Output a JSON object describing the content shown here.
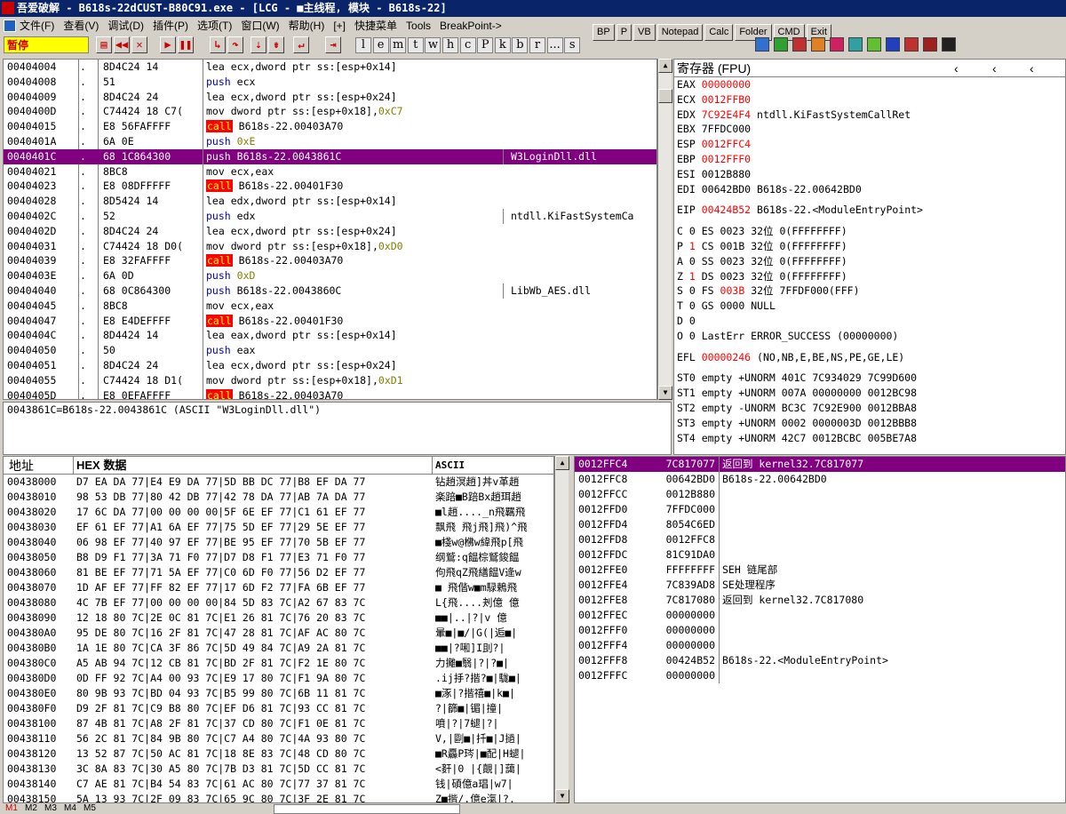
{
  "title": "吾爱破解 - B618s-22dCUST-B80C91.exe - [LCG - ■主线程, 模块 - B618s-22]",
  "menu": [
    "文件(F)",
    "查看(V)",
    "调试(D)",
    "插件(P)",
    "选项(T)",
    "窗口(W)",
    "帮助(H)",
    "[+]",
    "快捷菜单",
    "Tools",
    "BreakPoint->"
  ],
  "quick_buttons": [
    "BP",
    "P",
    "VB",
    "Notepad",
    "Calc",
    "Folder",
    "CMD",
    "Exit"
  ],
  "status": "暂停",
  "letters": [
    "l",
    "e",
    "m",
    "t",
    "w",
    "h",
    "c",
    "P",
    "k",
    "b",
    "r",
    "...",
    "s"
  ],
  "colors": {
    "selection": "#800080",
    "call_bg": "#ff0000",
    "paused_bg": "#ffff00",
    "title_bg": "#0a246a"
  },
  "cpu": [
    {
      "addr": "00404004",
      "dot": ".",
      "hex": "8D4C24 14",
      "op": "lea",
      "args": "ecx,dword ptr ss:[esp+0x14]",
      "cmt": ""
    },
    {
      "addr": "00404008",
      "dot": ".",
      "hex": "51",
      "op": "push",
      "args": "ecx",
      "cmt": ""
    },
    {
      "addr": "00404009",
      "dot": ".",
      "hex": "8D4C24 24",
      "op": "lea",
      "args": "ecx,dword ptr ss:[esp+0x24]",
      "cmt": ""
    },
    {
      "addr": "0040400D",
      "dot": ".",
      "hex": "C74424 18 C7(",
      "op": "mov",
      "args": "dword ptr ss:[esp+0x18],",
      "imm": "0xC7",
      "cmt": ""
    },
    {
      "addr": "00404015",
      "dot": ".",
      "hex": "E8 56FAFFFF",
      "op": "call",
      "args": "B618s-22.00403A70",
      "cmt": ""
    },
    {
      "addr": "0040401A",
      "dot": ".",
      "hex": "6A 0E",
      "op": "push",
      "args": "",
      "imm": "0xE",
      "cmt": ""
    },
    {
      "addr": "0040401C",
      "dot": ".",
      "hex": "68 1C864300",
      "op": "push",
      "args": "B618s-22.0043861C",
      "cmt": "W3LoginDll.dll",
      "sel": true
    },
    {
      "addr": "00404021",
      "dot": ".",
      "hex": "8BC8",
      "op": "mov",
      "args": "ecx,eax",
      "cmt": ""
    },
    {
      "addr": "00404023",
      "dot": ".",
      "hex": "E8 08DFFFFF",
      "op": "call",
      "args": "B618s-22.00401F30",
      "cmt": ""
    },
    {
      "addr": "00404028",
      "dot": ".",
      "hex": "8D5424 14",
      "op": "lea",
      "args": "edx,dword ptr ss:[esp+0x14]",
      "cmt": ""
    },
    {
      "addr": "0040402C",
      "dot": ".",
      "hex": "52",
      "op": "push",
      "args": "edx",
      "cmt": "ntdll.KiFastSystemCa"
    },
    {
      "addr": "0040402D",
      "dot": ".",
      "hex": "8D4C24 24",
      "op": "lea",
      "args": "ecx,dword ptr ss:[esp+0x24]",
      "cmt": ""
    },
    {
      "addr": "00404031",
      "dot": ".",
      "hex": "C74424 18 D0(",
      "op": "mov",
      "args": "dword ptr ss:[esp+0x18],",
      "imm": "0xD0",
      "cmt": ""
    },
    {
      "addr": "00404039",
      "dot": ".",
      "hex": "E8 32FAFFFF",
      "op": "call",
      "args": "B618s-22.00403A70",
      "cmt": ""
    },
    {
      "addr": "0040403E",
      "dot": ".",
      "hex": "6A 0D",
      "op": "push",
      "args": "",
      "imm": "0xD",
      "cmt": ""
    },
    {
      "addr": "00404040",
      "dot": ".",
      "hex": "68 0C864300",
      "op": "push",
      "args": "B618s-22.0043860C",
      "cmt": "LibWb_AES.dll"
    },
    {
      "addr": "00404045",
      "dot": ".",
      "hex": "8BC8",
      "op": "mov",
      "args": "ecx,eax",
      "cmt": ""
    },
    {
      "addr": "00404047",
      "dot": ".",
      "hex": "E8 E4DEFFFF",
      "op": "call",
      "args": "B618s-22.00401F30",
      "cmt": ""
    },
    {
      "addr": "0040404C",
      "dot": ".",
      "hex": "8D4424 14",
      "op": "lea",
      "args": "eax,dword ptr ss:[esp+0x14]",
      "cmt": ""
    },
    {
      "addr": "00404050",
      "dot": ".",
      "hex": "50",
      "op": "push",
      "args": "eax",
      "cmt": ""
    },
    {
      "addr": "00404051",
      "dot": ".",
      "hex": "8D4C24 24",
      "op": "lea",
      "args": "ecx,dword ptr ss:[esp+0x24]",
      "cmt": ""
    },
    {
      "addr": "00404055",
      "dot": ".",
      "hex": "C74424 18 D1(",
      "op": "mov",
      "args": "dword ptr ss:[esp+0x18],",
      "imm": "0xD1",
      "cmt": ""
    },
    {
      "addr": "0040405D",
      "dot": ".",
      "hex": "E8 0EFAFFFF",
      "op": "call",
      "args": "B618s-22.00403A70",
      "cmt": ""
    }
  ],
  "info": "0043861C=B618s-22.0043861C (ASCII \"W3LoginDll.dll\")",
  "regs_title": "寄存器 (FPU)",
  "regs": [
    {
      "n": "EAX",
      "v": "00000000",
      "r": true,
      "c": ""
    },
    {
      "n": "ECX",
      "v": "0012FFB0",
      "r": true,
      "c": ""
    },
    {
      "n": "EDX",
      "v": "7C92E4F4",
      "r": true,
      "c": "ntdll.KiFastSystemCallRet"
    },
    {
      "n": "EBX",
      "v": "7FFDC000",
      "r": false,
      "c": ""
    },
    {
      "n": "ESP",
      "v": "0012FFC4",
      "r": true,
      "c": ""
    },
    {
      "n": "EBP",
      "v": "0012FFF0",
      "r": true,
      "c": ""
    },
    {
      "n": "ESI",
      "v": "0012B880",
      "r": false,
      "c": ""
    },
    {
      "n": "EDI",
      "v": "00642BD0",
      "r": false,
      "c": "B618s-22.00642BD0"
    }
  ],
  "eip": {
    "n": "EIP",
    "v": "00424B52",
    "c": "B618s-22.<ModuleEntryPoint>"
  },
  "flags": [
    {
      "f": "C",
      "b": "0",
      "s": "ES",
      "v": "0023",
      "w": "32位",
      "d": "0(FFFFFFFF)",
      "r": false,
      "sr": false
    },
    {
      "f": "P",
      "b": "1",
      "s": "CS",
      "v": "001B",
      "w": "32位",
      "d": "0(FFFFFFFF)",
      "r": true,
      "sr": false
    },
    {
      "f": "A",
      "b": "0",
      "s": "SS",
      "v": "0023",
      "w": "32位",
      "d": "0(FFFFFFFF)",
      "r": false,
      "sr": false
    },
    {
      "f": "Z",
      "b": "1",
      "s": "DS",
      "v": "0023",
      "w": "32位",
      "d": "0(FFFFFFFF)",
      "r": true,
      "sr": false
    },
    {
      "f": "S",
      "b": "0",
      "s": "FS",
      "v": "003B",
      "w": "32位",
      "d": "7FFDF000(FFF)",
      "r": false,
      "sr": true
    },
    {
      "f": "T",
      "b": "0",
      "s": "GS",
      "v": "0000",
      "w": "NULL",
      "d": "",
      "r": false,
      "sr": false
    },
    {
      "f": "D",
      "b": "0",
      "s": "",
      "v": "",
      "w": "",
      "d": "",
      "r": false,
      "sr": false
    },
    {
      "f": "O",
      "b": "0",
      "s": "LastErr",
      "v": "ERROR_SUCCESS",
      "w": "(00000000)",
      "d": "",
      "r": false,
      "sr": false
    }
  ],
  "efl": {
    "n": "EFL",
    "v": "00000246",
    "c": "(NO,NB,E,BE,NS,PE,GE,LE)"
  },
  "fpu": [
    "ST0 empty +UNORM 401C 7C934029 7C99D600",
    "ST1 empty +UNORM 007A 00000000 0012BC98",
    "ST2 empty -UNORM BC3C 7C92E900 0012BBA8",
    "ST3 empty +UNORM 0002 0000003D 0012BBB8",
    "ST4 empty +UNORM 42C7 0012BCBC 005BE7A8"
  ],
  "dump_headers": {
    "addr": "地址",
    "hex": "HEX 数据",
    "ascii": "ASCII"
  },
  "dump": [
    {
      "a": "00438000",
      "h": "D7 EA DA 77|E4 E9 DA 77|5D BB DC 77|B8 EF DA 77",
      "s": "钻趙溟趙]丼v革趙"
    },
    {
      "a": "00438010",
      "h": "98 53 DB 77|80 42 DB 77|42 78 DA 77|AB 7A DA 77",
      "s": "楽踣■B踣Bx趙珥趙"
    },
    {
      "a": "00438020",
      "h": "17 6C DA 77|00 00 00 00|5F 6E EF 77|C1 61 EF 77",
      "s": "■l趙...._n飛羈飛"
    },
    {
      "a": "00438030",
      "h": "EF 61 EF 77|A1 6A EF 77|75 5D EF 77|29 5E EF 77",
      "s": "飘飛 飛j飛]飛)^飛"
    },
    {
      "a": "00438040",
      "h": "06 98 EF 77|40 97 EF 77|BE 95 EF 77|70 5B EF 77",
      "s": "■棧w@梻w緯飛p[飛"
    },
    {
      "a": "00438050",
      "h": "B8 D9 F1 77|3A 71 F0 77|D7 D8 F1 77|E3 71 F0 77",
      "s": "纲鷲:q饂棕鷲鋑饂"
    },
    {
      "a": "00438060",
      "h": "81 BE EF 77|71 5A EF 77|C0 6D F0 77|56 D2 EF 77",
      "s": "佝飛qZ飛繕饂V逄w"
    },
    {
      "a": "00438070",
      "h": "1D AF EF 77|FF 82 EF 77|17 6D F2 77|FA 6B EF 77",
      "s": "■ 飛偕w■m騄鶫飛"
    },
    {
      "a": "00438080",
      "h": "4C 7B EF 77|00 00 00 00|84 5D 83 7C|A2 67 83 7C",
      "s": "L{飛....刔億 億"
    },
    {
      "a": "00438090",
      "h": "12 18 80 7C|2E 0C 81 7C|E1 26 81 7C|76 20 83 7C",
      "s": "■■|..|?|v 億"
    },
    {
      "a": "004380A0",
      "h": "95 DE 80 7C|16 2F 81 7C|47 28 81 7C|AF AC 80 7C",
      "s": "暈■|■/|G(|逅■|"
    },
    {
      "a": "004380B0",
      "h": "1A 1E 80 7C|CA 3F 86 7C|5D 49 84 7C|A9 2A 81 7C",
      "s": "■■|?啝]I刞?|"
    },
    {
      "a": "004380C0",
      "h": "A5 AB 94 7C|12 CB 81 7C|BD 2F 81 7C|F2 1E 80 7C",
      "s": "力攡■翳|?|?■|"
    },
    {
      "a": "004380D0",
      "h": "0D FF 92 7C|A4 00 93 7C|E9 17 80 7C|F1 9A 80 7C",
      "s": ".ij抙?揩?■|駹■|"
    },
    {
      "a": "004380E0",
      "h": "80 9B 93 7C|BD 04 93 7C|B5 99 80 7C|6B 11 81 7C",
      "s": "■涿|?揩禧■|k■|"
    },
    {
      "a": "004380F0",
      "h": "D9 2F 81 7C|C9 B8 80 7C|EF D6 81 7C|93 CC 81 7C",
      "s": "?|篩■|镅|撞|"
    },
    {
      "a": "00438100",
      "h": "87 4B 81 7C|A8 2F 81 7C|37 CD 80 7C|F1 0E 81 7C",
      "s": "噴|?|7螁|?|"
    },
    {
      "a": "00438110",
      "h": "56 2C 81 7C|84 9B 80 7C|C7 A4 80 7C|4A 93 80 7C",
      "s": "V,|剾■|扦■|J撾|"
    },
    {
      "a": "00438120",
      "h": "13 52 87 7C|50 AC 81 7C|18 8E 83 7C|48 CD 80 7C",
      "s": "■R厵P琌|■配|H螁|"
    },
    {
      "a": "00438130",
      "h": "3C 8A 83 7C|30 A5 80 7C|7B D3 81 7C|5D CC 81 7C",
      "s": "<姧|0 |{覿|]藹|"
    },
    {
      "a": "00438140",
      "h": "C7 AE 81 7C|B4 54 83 7C|61 AC 80 7C|77 37 81 7C",
      "s": "钱|碩億a琩|w7|"
    },
    {
      "a": "00438150",
      "h": "5A 13 93 7C|2F 09 83 7C|65 9C 80 7C|3F 2E 81 7C",
      "s": "Z■揩/.億e滊|?."
    }
  ],
  "stack": [
    {
      "a": "0012FFC4",
      "v": "7C817077",
      "c": "返回到 kernel32.7C817077",
      "sel": true
    },
    {
      "a": "0012FFC8",
      "v": "00642BD0",
      "c": "B618s-22.00642BD0"
    },
    {
      "a": "0012FFCC",
      "v": "0012B880",
      "c": ""
    },
    {
      "a": "0012FFD0",
      "v": "7FFDC000",
      "c": ""
    },
    {
      "a": "0012FFD4",
      "v": "8054C6ED",
      "c": ""
    },
    {
      "a": "0012FFD8",
      "v": "0012FFC8",
      "c": ""
    },
    {
      "a": "0012FFDC",
      "v": "81C91DA0",
      "c": ""
    },
    {
      "a": "0012FFE0",
      "v": "FFFFFFFF",
      "c": "SEH 链尾部"
    },
    {
      "a": "0012FFE4",
      "v": "7C839AD8",
      "c": "SE处理程序"
    },
    {
      "a": "0012FFE8",
      "v": "7C817080",
      "c": "返回到 kernel32.7C817080"
    },
    {
      "a": "0012FFEC",
      "v": "00000000",
      "c": ""
    },
    {
      "a": "0012FFF0",
      "v": "00000000",
      "c": ""
    },
    {
      "a": "0012FFF4",
      "v": "00000000",
      "c": ""
    },
    {
      "a": "0012FFF8",
      "v": "00424B52",
      "c": "B618s-22.<ModuleEntryPoint>"
    },
    {
      "a": "0012FFFC",
      "v": "00000000",
      "c": ""
    }
  ],
  "bottom_tabs": [
    "M1",
    "M2",
    "M3",
    "M4",
    "M5"
  ]
}
